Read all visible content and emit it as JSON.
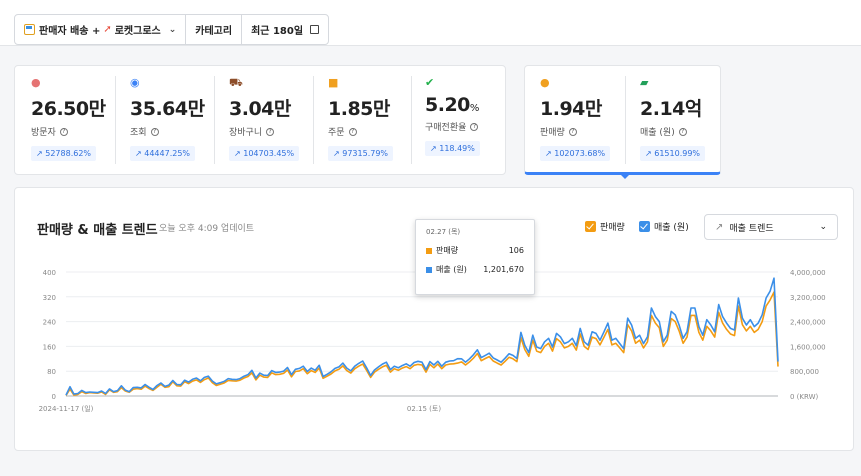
{
  "filters": {
    "channel_a": "판매자 배송 +",
    "channel_b": "로켓그로스",
    "category": "카테고리",
    "period": "최근 180일"
  },
  "metrics": [
    {
      "icon": "visitor-icon",
      "value": "26.50만",
      "label": "방문자",
      "change": "52788.62%",
      "color": "#e57373"
    },
    {
      "icon": "eye-icon",
      "value": "35.64만",
      "label": "조회",
      "change": "44447.25%",
      "color": "#3b82f6"
    },
    {
      "icon": "cart-icon",
      "value": "3.04만",
      "label": "장바구니",
      "change": "104703.45%",
      "color": "#8d4e2a"
    },
    {
      "icon": "box-icon",
      "value": "1.85만",
      "label": "주문",
      "change": "97315.79%",
      "color": "#f0a020"
    },
    {
      "icon": "check-circle-icon",
      "value": "5.20",
      "unit": "%",
      "label": "구매전환율",
      "change": "118.49%",
      "color": "#22b14c"
    }
  ],
  "metrics_right": [
    {
      "icon": "coins-icon",
      "value": "1.94만",
      "label": "판매량",
      "change": "102073.68%",
      "color": "#f0a020"
    },
    {
      "icon": "money-icon",
      "value": "2.14억",
      "label": "매출 (원)",
      "change": "61510.99%",
      "color": "#22a05a"
    }
  ],
  "chart_card": {
    "title": "판매량 & 매출 트렌드",
    "updated": "오늘 오후 4:09 업데이트",
    "legend_qty": "판매량",
    "legend_rev": "매출 (원)",
    "dropdown": "매출 트렌드"
  },
  "tooltip": {
    "date": "02.27 (목)",
    "qty_label": "판매량",
    "qty_value": "106",
    "rev_label": "매출 (원)",
    "rev_value": "1,201,670"
  },
  "chart_data": {
    "type": "line",
    "x_start_label": "2024-11-17 (일)",
    "x_mid_label": "02.15 (토)",
    "y_left_ticks": [
      "0",
      "80",
      "160",
      "240",
      "320",
      "400"
    ],
    "y_right_ticks": [
      "0 (KRW)",
      "800,000",
      "1,600,000",
      "2,400,000",
      "3,200,000",
      "4,000,000"
    ],
    "ylim_left": [
      0,
      400
    ],
    "ylim_right": [
      0,
      4000000
    ],
    "colors": {
      "qty": "#f39c12",
      "rev": "#3b8fe8"
    },
    "series": [
      {
        "name": "판매량",
        "axis": "left",
        "values": [
          2,
          22,
          3,
          5,
          14,
          8,
          11,
          10,
          9,
          13,
          5,
          20,
          12,
          14,
          27,
          16,
          12,
          22,
          24,
          22,
          32,
          24,
          18,
          28,
          38,
          28,
          30,
          46,
          33,
          32,
          46,
          40,
          48,
          52,
          44,
          53,
          58,
          43,
          34,
          38,
          42,
          50,
          49,
          48,
          51,
          58,
          63,
          75,
          52,
          67,
          61,
          60,
          75,
          69,
          70,
          73,
          84,
          62,
          79,
          81,
          88,
          72,
          82,
          76,
          90,
          57,
          64,
          71,
          81,
          86,
          97,
          82,
          74,
          88,
          96,
          103,
          83,
          60,
          77,
          86,
          94,
          99,
          77,
          88,
          83,
          90,
          95,
          88,
          99,
          102,
          100,
          77,
          102,
          91,
          103,
          88,
          100,
          103,
          104,
          106,
          110,
          100,
          110,
          122,
          137,
          114,
          121,
          127,
          113,
          106,
          100,
          112,
          125,
          120,
          111,
          188,
          150,
          128,
          180,
          145,
          140,
          160,
          170,
          145,
          185,
          175,
          155,
          160,
          170,
          148,
          200,
          160,
          150,
          190,
          185,
          165,
          190,
          215,
          165,
          170,
          155,
          140,
          230,
          210,
          170,
          180,
          155,
          175,
          260,
          235,
          220,
          160,
          180,
          250,
          240,
          210,
          170,
          190,
          260,
          260,
          205,
          180,
          225,
          210,
          190,
          270,
          235,
          215,
          200,
          195,
          290,
          230,
          210,
          225,
          205,
          215,
          240,
          290,
          310,
          335,
          95
        ]
      },
      {
        "name": "매출 (원)",
        "axis": "right",
        "values": [
          30000,
          300000,
          60000,
          80000,
          180000,
          110000,
          130000,
          120000,
          110000,
          160000,
          80000,
          230000,
          140000,
          170000,
          330000,
          190000,
          140000,
          270000,
          280000,
          260000,
          370000,
          280000,
          210000,
          340000,
          420000,
          310000,
          350000,
          500000,
          370000,
          360000,
          510000,
          450000,
          540000,
          580000,
          490000,
          600000,
          640000,
          480000,
          390000,
          430000,
          470000,
          560000,
          540000,
          530000,
          560000,
          640000,
          690000,
          830000,
          580000,
          740000,
          670000,
          660000,
          820000,
          760000,
          770000,
          800000,
          920000,
          690000,
          860000,
          890000,
          960000,
          790000,
          900000,
          830000,
          990000,
          630000,
          700000,
          780000,
          890000,
          940000,
          1060000,
          900000,
          810000,
          960000,
          1050000,
          1130000,
          910000,
          660000,
          840000,
          940000,
          1030000,
          1090000,
          850000,
          960000,
          910000,
          980000,
          1040000,
          960000,
          1080000,
          1120000,
          1090000,
          850000,
          1110000,
          1000000,
          1120000,
          960000,
          1090000,
          1130000,
          1140000,
          1201670,
          1200000,
          1090000,
          1200000,
          1330000,
          1490000,
          1240000,
          1310000,
          1380000,
          1230000,
          1160000,
          1090000,
          1220000,
          1360000,
          1310000,
          1210000,
          2050000,
          1640000,
          1400000,
          1960000,
          1580000,
          1530000,
          1750000,
          1860000,
          1580000,
          2020000,
          1910000,
          1690000,
          1750000,
          1860000,
          1620000,
          2180000,
          1750000,
          1640000,
          2070000,
          2020000,
          1800000,
          2070000,
          2350000,
          1800000,
          1860000,
          1690000,
          1530000,
          2510000,
          2290000,
          1860000,
          1960000,
          1690000,
          1910000,
          2840000,
          2560000,
          2400000,
          1750000,
          1960000,
          2730000,
          2620000,
          2290000,
          1860000,
          2070000,
          2840000,
          2840000,
          2240000,
          1960000,
          2460000,
          2290000,
          2070000,
          2950000,
          2560000,
          2350000,
          2180000,
          2130000,
          3160000,
          2510000,
          2290000,
          2460000,
          2240000,
          2350000,
          2620000,
          3160000,
          3380000,
          3800000,
          1110000
        ]
      }
    ],
    "grid": true,
    "legend": "top-right"
  }
}
